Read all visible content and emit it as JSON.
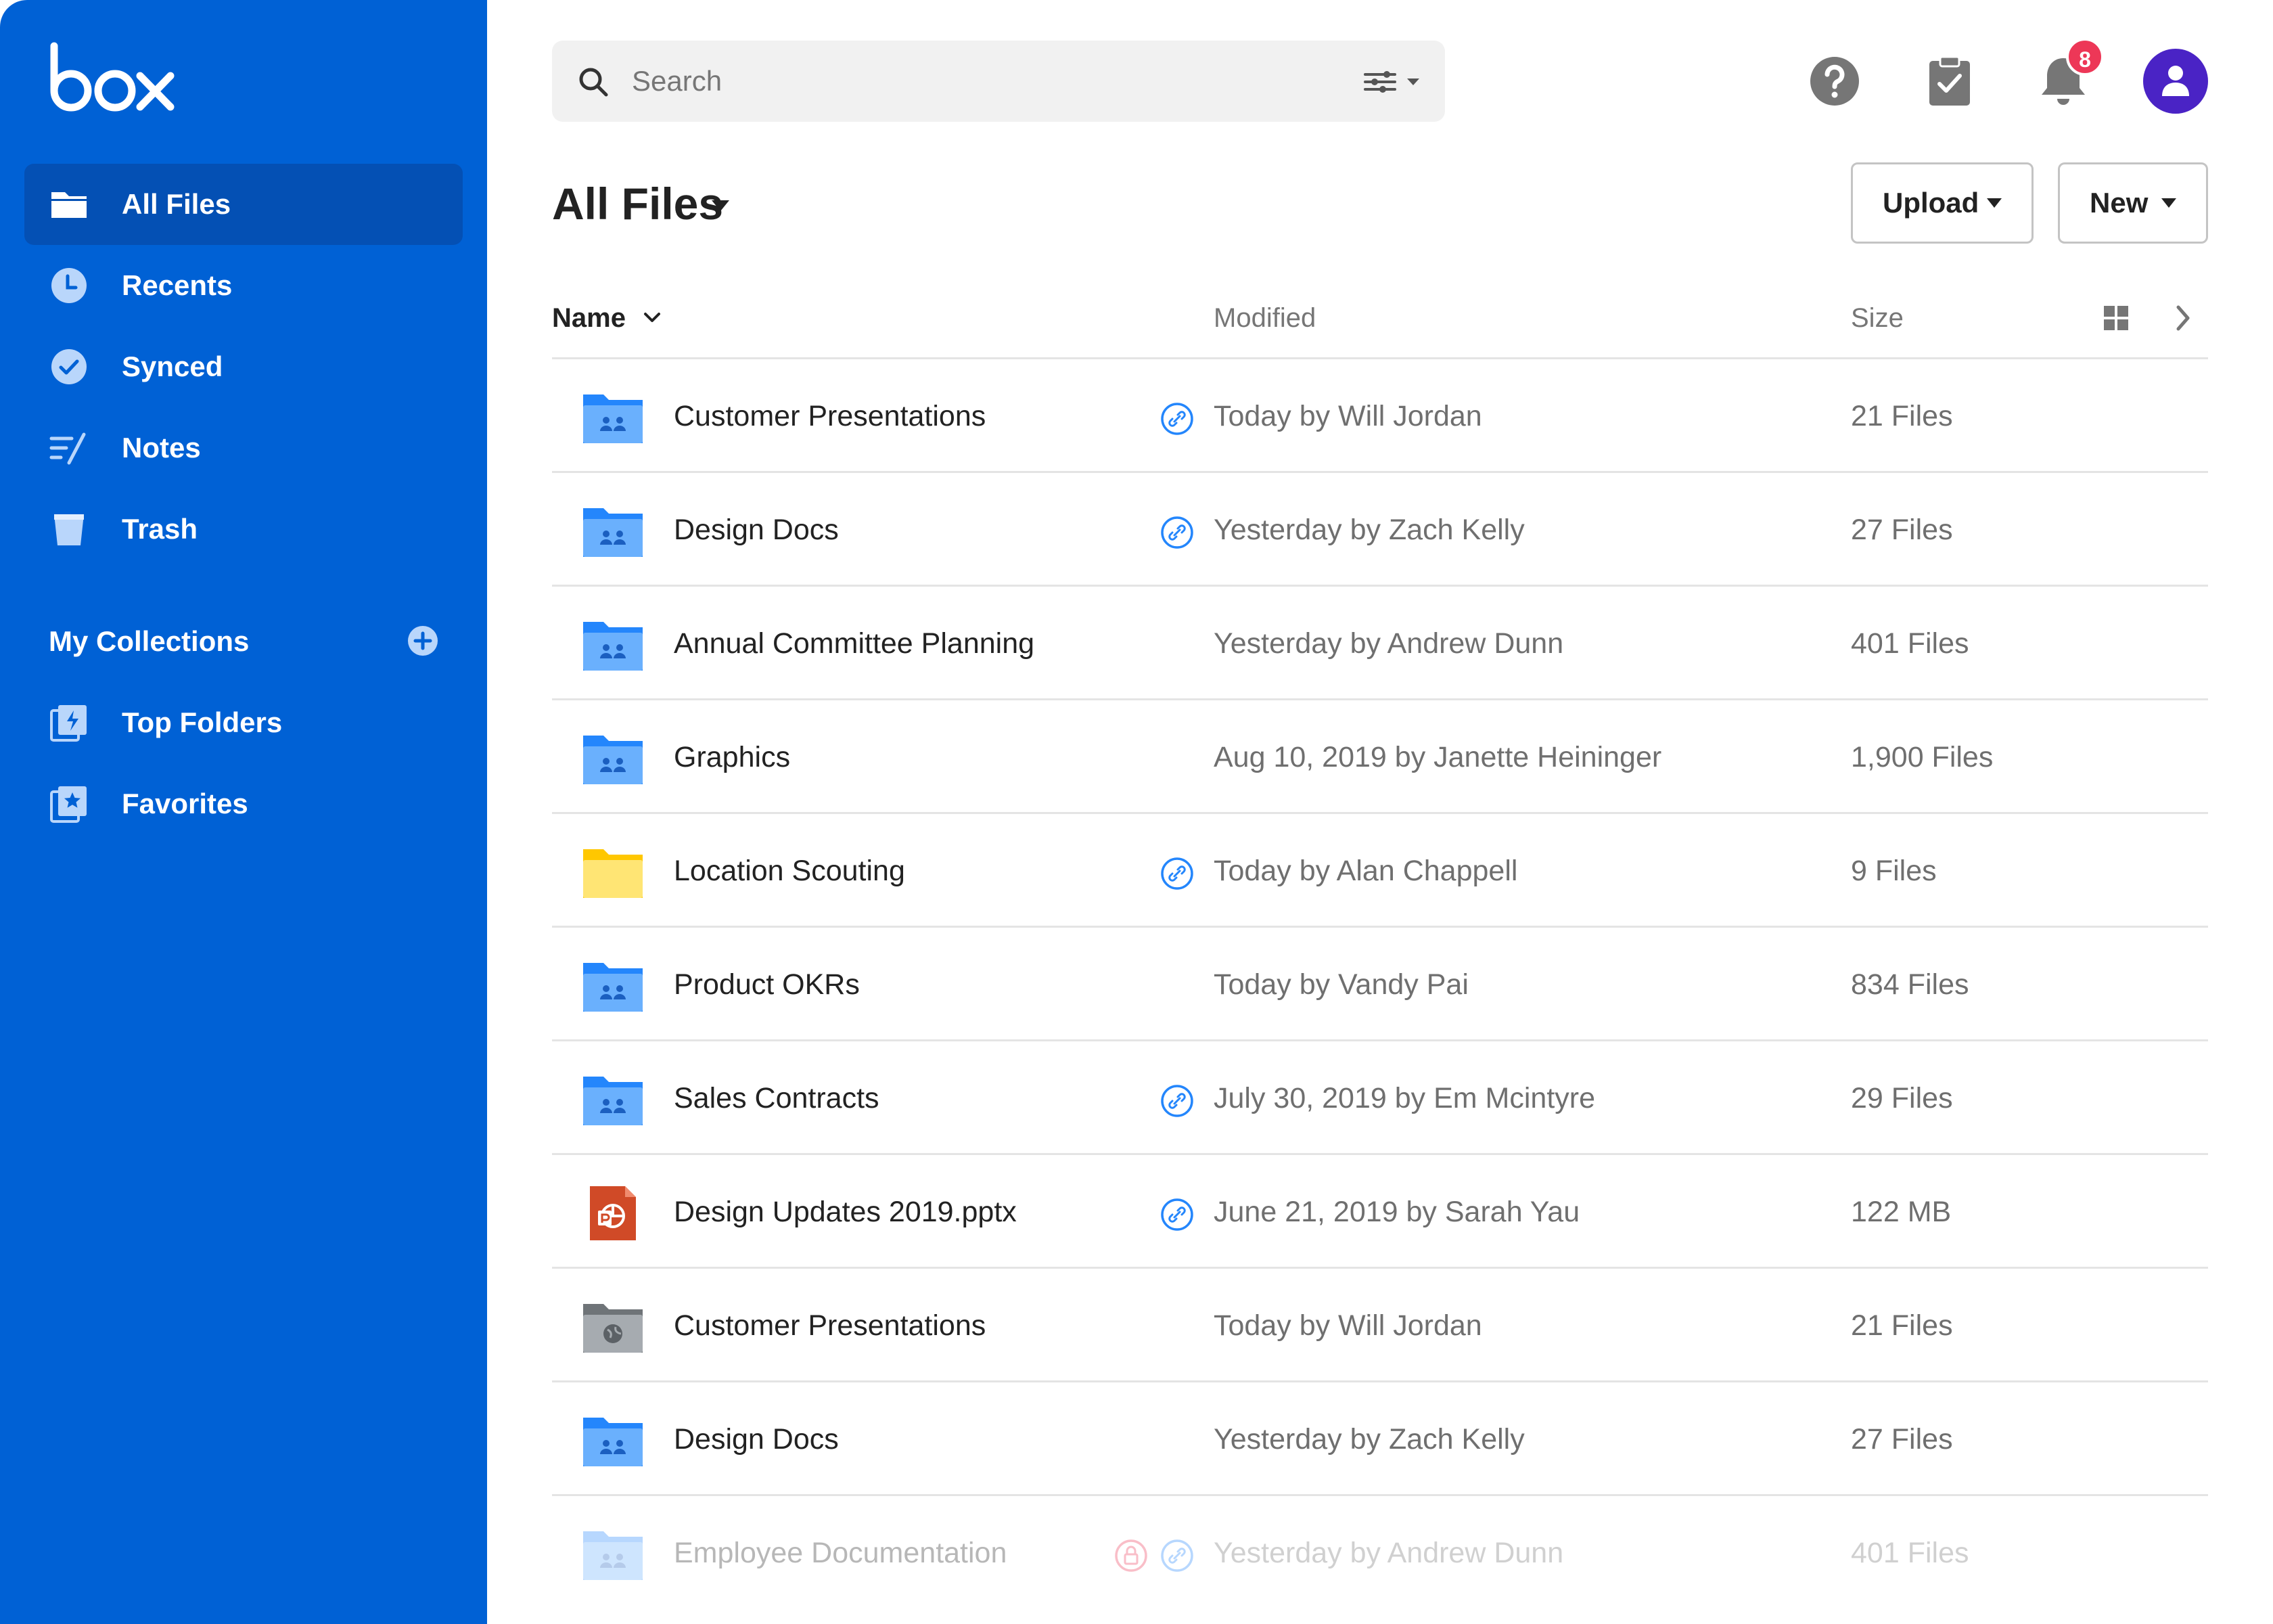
{
  "app": {
    "logo_text": "box"
  },
  "sidebar": {
    "items": [
      {
        "label": "All Files",
        "icon": "folder-icon",
        "active": true
      },
      {
        "label": "Recents",
        "icon": "clock-icon"
      },
      {
        "label": "Synced",
        "icon": "check-circle-icon"
      },
      {
        "label": "Notes",
        "icon": "notes-icon"
      },
      {
        "label": "Trash",
        "icon": "trash-icon"
      }
    ],
    "collections_title": "My Collections",
    "collections": [
      {
        "label": "Top Folders",
        "icon": "bolt-collection-icon"
      },
      {
        "label": "Favorites",
        "icon": "star-collection-icon"
      }
    ]
  },
  "search": {
    "placeholder": "Search"
  },
  "notifications": {
    "count": "8"
  },
  "header": {
    "title": "All Files",
    "upload_label": "Upload",
    "new_label": "New"
  },
  "table": {
    "columns": {
      "name": "Name",
      "modified": "Modified",
      "size": "Size"
    },
    "rows": [
      {
        "name": "Customer Presentations",
        "modified": "Today by Will Jordan",
        "size": "21 Files",
        "icon": "collab-folder-icon",
        "linked": true
      },
      {
        "name": "Design Docs",
        "modified": "Yesterday by Zach Kelly",
        "size": "27 Files",
        "icon": "collab-folder-icon",
        "linked": true
      },
      {
        "name": "Annual Committee Planning",
        "modified": "Yesterday by Andrew Dunn",
        "size": "401 Files",
        "icon": "collab-folder-icon",
        "linked": false
      },
      {
        "name": "Graphics",
        "modified": "Aug 10, 2019 by Janette Heininger",
        "size": "1,900 Files",
        "icon": "collab-folder-icon",
        "linked": false
      },
      {
        "name": "Location Scouting",
        "modified": "Today by Alan Chappell",
        "size": "9 Files",
        "icon": "personal-folder-icon",
        "linked": true
      },
      {
        "name": "Product OKRs",
        "modified": "Today by Vandy Pai",
        "size": "834 Files",
        "icon": "collab-folder-icon",
        "linked": false
      },
      {
        "name": "Sales Contracts",
        "modified": "July 30, 2019 by Em Mcintyre",
        "size": "29 Files",
        "icon": "collab-folder-icon",
        "linked": true
      },
      {
        "name": "Design Updates 2019.pptx",
        "modified": "June 21, 2019 by Sarah Yau",
        "size": "122 MB",
        "icon": "powerpoint-file-icon",
        "linked": true
      },
      {
        "name": "Customer Presentations",
        "modified": "Today by Will Jordan",
        "size": "21 Files",
        "icon": "external-folder-icon",
        "linked": false
      },
      {
        "name": "Design Docs",
        "modified": "Yesterday by Zach Kelly",
        "size": "27 Files",
        "icon": "collab-folder-icon",
        "linked": false
      },
      {
        "name": "Employee Documentation",
        "modified": "Yesterday by Andrew Dunn",
        "size": "401 Files",
        "icon": "collab-folder-icon",
        "linked": true,
        "locked": true
      }
    ]
  },
  "colors": {
    "sidebar_bg": "#0061d5",
    "sidebar_active": "#0450b4",
    "folder_blue": "#2486fc",
    "folder_yellow": "#ffd700",
    "avatar": "#4a23c5",
    "badge": "#ed3757",
    "link_icon": "#2486fc"
  }
}
